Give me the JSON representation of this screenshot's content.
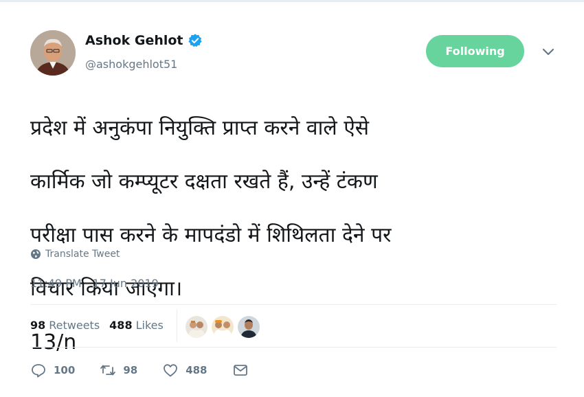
{
  "author": {
    "display_name": "Ashok Gehlot",
    "handle": "@ashokgehlot51",
    "verified": true
  },
  "follow_button": {
    "label": "Following",
    "color": "#66d49c"
  },
  "tweet": {
    "lines": [
      "प्रदेश में अनुकंपा नियुक्ति प्राप्त करने वाले ऐसे",
      "कार्मिक जो कम्प्यूटर दक्षता रखते हैं, उन्हें टंकण",
      "परीक्षा पास करने के मापदंडो में शिथिलता देने पर",
      "विचार किया जाएगा।",
      "13/n"
    ]
  },
  "translate_label": "Translate Tweet",
  "timestamp": "11:49 PM - 17 Jun 2019",
  "stats": {
    "retweets_count": "98",
    "retweets_label": "Retweets",
    "likes_count": "488",
    "likes_label": "Likes"
  },
  "actions": {
    "reply_count": "100",
    "retweet_count": "98",
    "like_count": "488"
  },
  "icons": {
    "verified": "verified-badge-icon",
    "caret": "chevron-down-icon",
    "translate": "globe-icon",
    "reply": "reply-icon",
    "retweet": "retweet-icon",
    "like": "heart-icon",
    "message": "envelope-icon"
  },
  "colors": {
    "accent": "#1da1f2",
    "muted": "#657786",
    "follow": "#66d49c"
  }
}
